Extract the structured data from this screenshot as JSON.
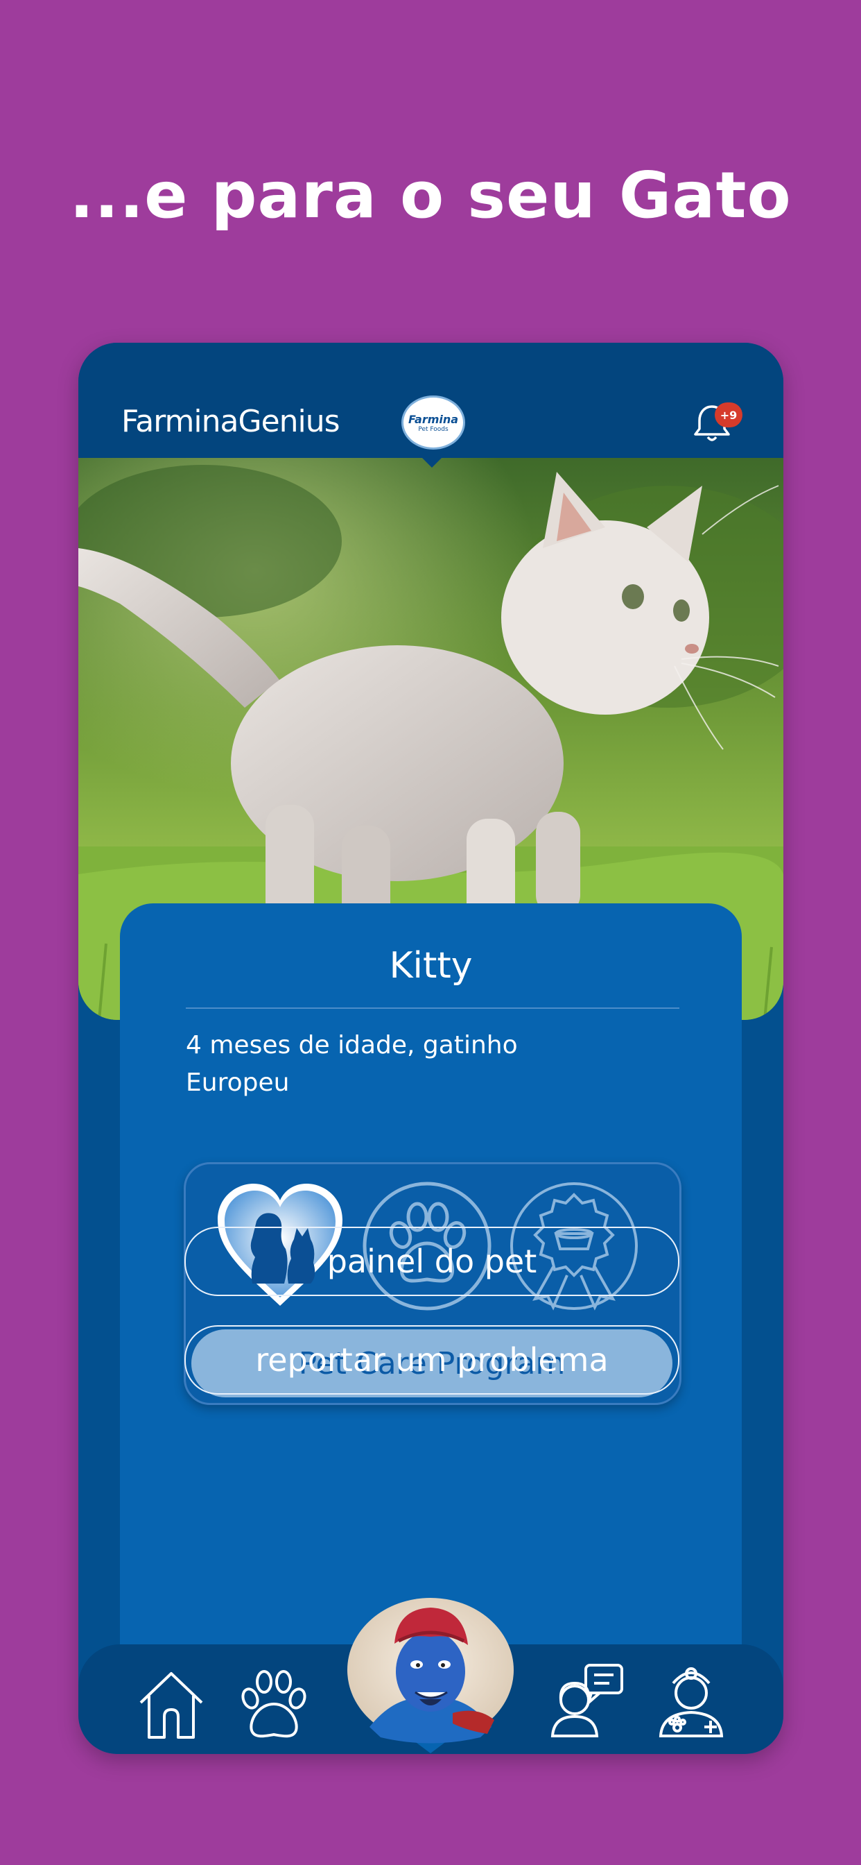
{
  "headline": "...e para o seu Gato",
  "appbar": {
    "brand": "FarminaGenius",
    "logo_main": "Farmina",
    "logo_sub": "Pet Foods",
    "notification_count": "+9",
    "bell_icon": "bell-icon"
  },
  "pet": {
    "name": "Kitty",
    "description_line1": "4 meses de idade, gatinho",
    "description_line2": "Europeu"
  },
  "program": {
    "icons": [
      "heart-pets-icon",
      "paw-circle-icon",
      "food-bowl-award-icon"
    ],
    "button_label": "Pet Care Program"
  },
  "actions": {
    "dashboard_label": "painel do pet",
    "report_label": "reportar um problema"
  },
  "bottom_nav": {
    "items": [
      "home-icon",
      "paw-icon",
      "genie-avatar",
      "chat-person-icon",
      "vet-icon"
    ]
  },
  "colors": {
    "background": "#9e3c9c",
    "app_dark_blue": "#03457e",
    "card_blue": "#0764b0",
    "button_light_blue": "#8ab5dc",
    "badge_red": "#d63b2b"
  }
}
